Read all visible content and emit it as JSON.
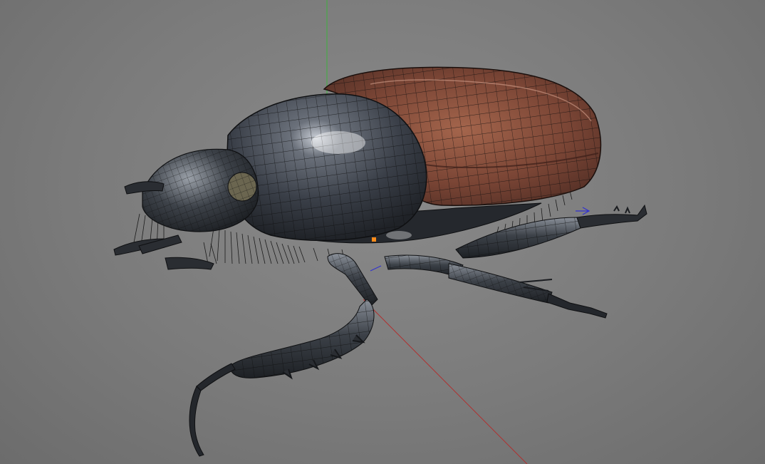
{
  "viewport": {
    "background_color": "#7f7f7f",
    "axis_colors": {
      "x_axis": "#b03030",
      "y_axis": "#3db03d",
      "z_axis": "#3030d0"
    },
    "pivot_color": "#ff8c1a",
    "model": {
      "material_colors": {
        "pronotum": "#3a3f48",
        "elytra": "#7a4535",
        "legs": "#353a41",
        "wireframe": "#111111"
      }
    }
  }
}
